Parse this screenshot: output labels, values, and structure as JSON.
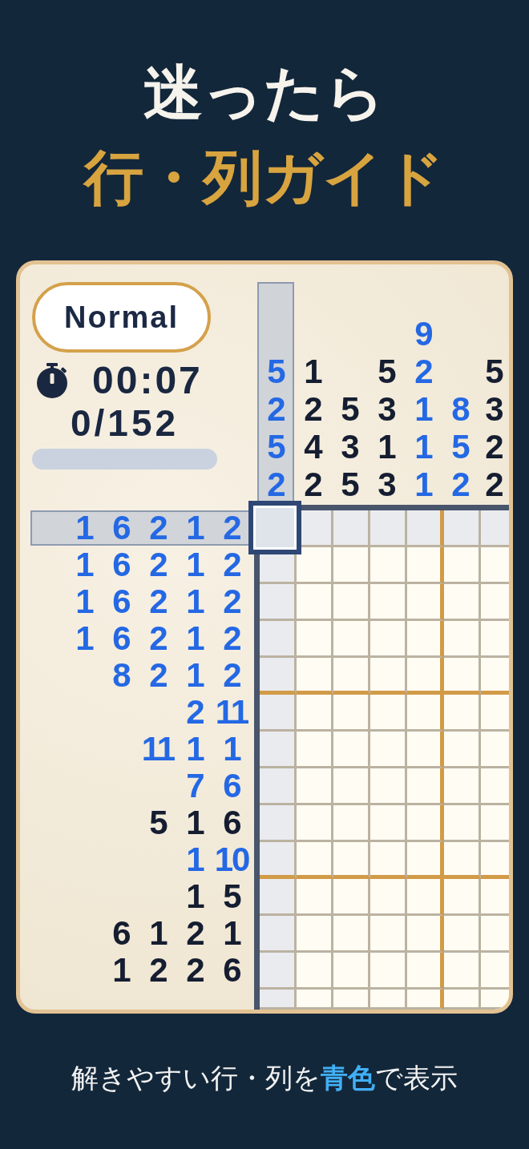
{
  "headline": {
    "line_1": "迷ったら",
    "line_2": "行・列ガイド"
  },
  "card": {
    "difficulty": "Normal",
    "timer": "00:07",
    "progress_text": "0/152",
    "column_clues": [
      {
        "numbers": [
          "5",
          "2",
          "5",
          "2"
        ],
        "easy_to_solve": true,
        "selected": true
      },
      {
        "numbers": [
          "1",
          "2",
          "4",
          "2"
        ],
        "easy_to_solve": false,
        "selected": false
      },
      {
        "numbers": [
          "5",
          "3",
          "5"
        ],
        "easy_to_solve": false,
        "selected": false
      },
      {
        "numbers": [
          "5",
          "3",
          "1",
          "3"
        ],
        "easy_to_solve": false,
        "selected": false
      },
      {
        "numbers": [
          "9",
          "2",
          "1",
          "1",
          "1"
        ],
        "easy_to_solve": true,
        "selected": false
      },
      {
        "numbers": [
          "8",
          "5",
          "2"
        ],
        "easy_to_solve": true,
        "selected": false
      },
      {
        "numbers": [
          "5",
          "3",
          "2",
          "2"
        ],
        "easy_to_solve": false,
        "selected": false
      }
    ],
    "row_clues": [
      {
        "numbers": [
          "1",
          "6",
          "2",
          "1",
          "2"
        ],
        "easy_to_solve": true,
        "selected": true
      },
      {
        "numbers": [
          "1",
          "6",
          "2",
          "1",
          "2"
        ],
        "easy_to_solve": true,
        "selected": false
      },
      {
        "numbers": [
          "1",
          "6",
          "2",
          "1",
          "2"
        ],
        "easy_to_solve": true,
        "selected": false
      },
      {
        "numbers": [
          "1",
          "6",
          "2",
          "1",
          "2"
        ],
        "easy_to_solve": true,
        "selected": false
      },
      {
        "numbers": [
          "8",
          "2",
          "1",
          "2"
        ],
        "easy_to_solve": true,
        "selected": false
      },
      {
        "numbers": [
          "2",
          "11"
        ],
        "easy_to_solve": true,
        "selected": false
      },
      {
        "numbers": [
          "11",
          "1",
          "1"
        ],
        "easy_to_solve": true,
        "selected": false
      },
      {
        "numbers": [
          "7",
          "6"
        ],
        "easy_to_solve": true,
        "selected": false
      },
      {
        "numbers": [
          "5",
          "1",
          "6"
        ],
        "easy_to_solve": false,
        "selected": false
      },
      {
        "numbers": [
          "1",
          "10"
        ],
        "easy_to_solve": true,
        "selected": false
      },
      {
        "numbers": [
          "1",
          "5"
        ],
        "easy_to_solve": false,
        "selected": false
      },
      {
        "numbers": [
          "6",
          "1",
          "2",
          "1"
        ],
        "easy_to_solve": false,
        "selected": false
      },
      {
        "numbers": [
          "1",
          "2",
          "2",
          "6"
        ],
        "easy_to_solve": false,
        "selected": false
      }
    ]
  },
  "caption": "解きやすい行・列を**青色**で表示"
}
